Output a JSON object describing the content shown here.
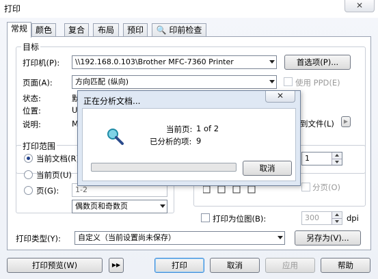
{
  "window": {
    "title": "打印",
    "close": "✕"
  },
  "tabs": [
    {
      "label": "常规",
      "active": true
    },
    {
      "label": "颜色"
    },
    {
      "label": "复合"
    },
    {
      "label": "布局"
    },
    {
      "label": "预印"
    },
    {
      "label": "印前检查"
    }
  ],
  "target": {
    "group_label": "目标",
    "printer_label": "打印机(P):",
    "printer_value": "\\\\192.168.0.103\\Brother MFC-7360 Printer",
    "prefs_button": "首选项(P)...",
    "page_label": "页面(A):",
    "page_value": "方向匹配 (纵向)",
    "use_ppd_label": "使用 PPD(E)",
    "status_label": "状态:",
    "status_value_partial": "默",
    "location_label": "位置:",
    "location_value_partial": "US",
    "comment_label": "说明:",
    "comment_value_partial": "M",
    "print_to_file_partial": "到文件(L)"
  },
  "print_range": {
    "group_label": "打印范围",
    "current_doc": "当前文档(R)",
    "current_page": "当前页(U)",
    "pages": "页(G):",
    "pages_value": "1-2",
    "odd_even_value": "偶数页和奇数页"
  },
  "copies": {
    "copies_value": "1",
    "collate_label": "分页(O)"
  },
  "bitmap": {
    "label": "打印为位图(B):",
    "dpi_value": "300",
    "dpi_unit": "dpi"
  },
  "print_type": {
    "label": "打印类型(Y):",
    "value": "自定义（当前设置尚未保存）",
    "save_as_button": "另存为(V)..."
  },
  "bottom": {
    "preview_button": "打印预览(W)",
    "expand_button": "▶▶",
    "print_button": "打印",
    "cancel_button": "取消",
    "apply_button": "应用",
    "help_button": "帮助"
  },
  "popup": {
    "title": "正在分析文档...",
    "close": "✕",
    "current_page_label": "当前页:",
    "current_page_value": "1 of 2",
    "analyzed_label": "已分析的项:",
    "analyzed_value": "9",
    "cancel_button": "取消",
    "progress_fraction": 0.0
  }
}
